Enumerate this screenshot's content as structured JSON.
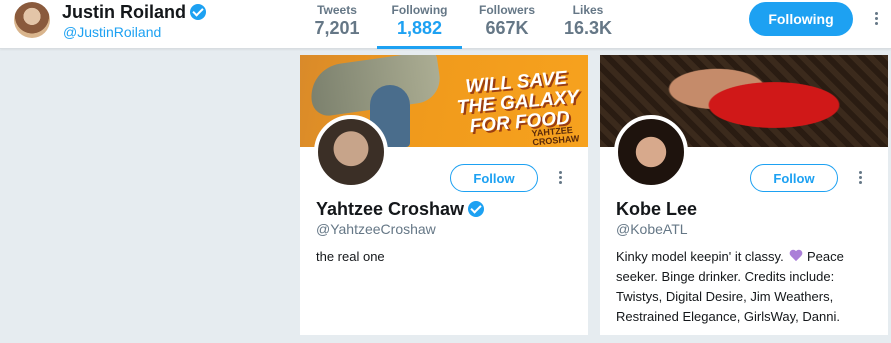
{
  "header": {
    "name": "Justin Roiland",
    "handle": "@JustinRoiland",
    "follow_label": "Following",
    "stats": [
      {
        "label": "Tweets",
        "value": "7,201"
      },
      {
        "label": "Following",
        "value": "1,882"
      },
      {
        "label": "Followers",
        "value": "667K"
      },
      {
        "label": "Likes",
        "value": "16.3K"
      }
    ]
  },
  "cards": [
    {
      "name": "Yahtzee Croshaw",
      "verified": true,
      "handle": "@YahtzeeCroshaw",
      "bio": "the real one",
      "follow_label": "Follow",
      "banner_text": "WILL SAVE THE GALAXY FOR FOOD",
      "banner_sub": "YAHTZEE CROSHAW"
    },
    {
      "name": "Kobe Lee",
      "verified": false,
      "handle": "@KobeATL",
      "bio_part1": "Kinky model keepin' it classy.",
      "bio_part2": "Peace seeker. Binge drinker. Credits include: Twistys, Digital Desire, Jim Weathers, Restrained Elegance, GirlsWay, Danni.",
      "bio_emoji": "purple-heart-icon",
      "follow_label": "Follow"
    }
  ],
  "colors": {
    "accent": "#1da1f2",
    "background": "#e6ecf0",
    "muted": "#657786"
  }
}
